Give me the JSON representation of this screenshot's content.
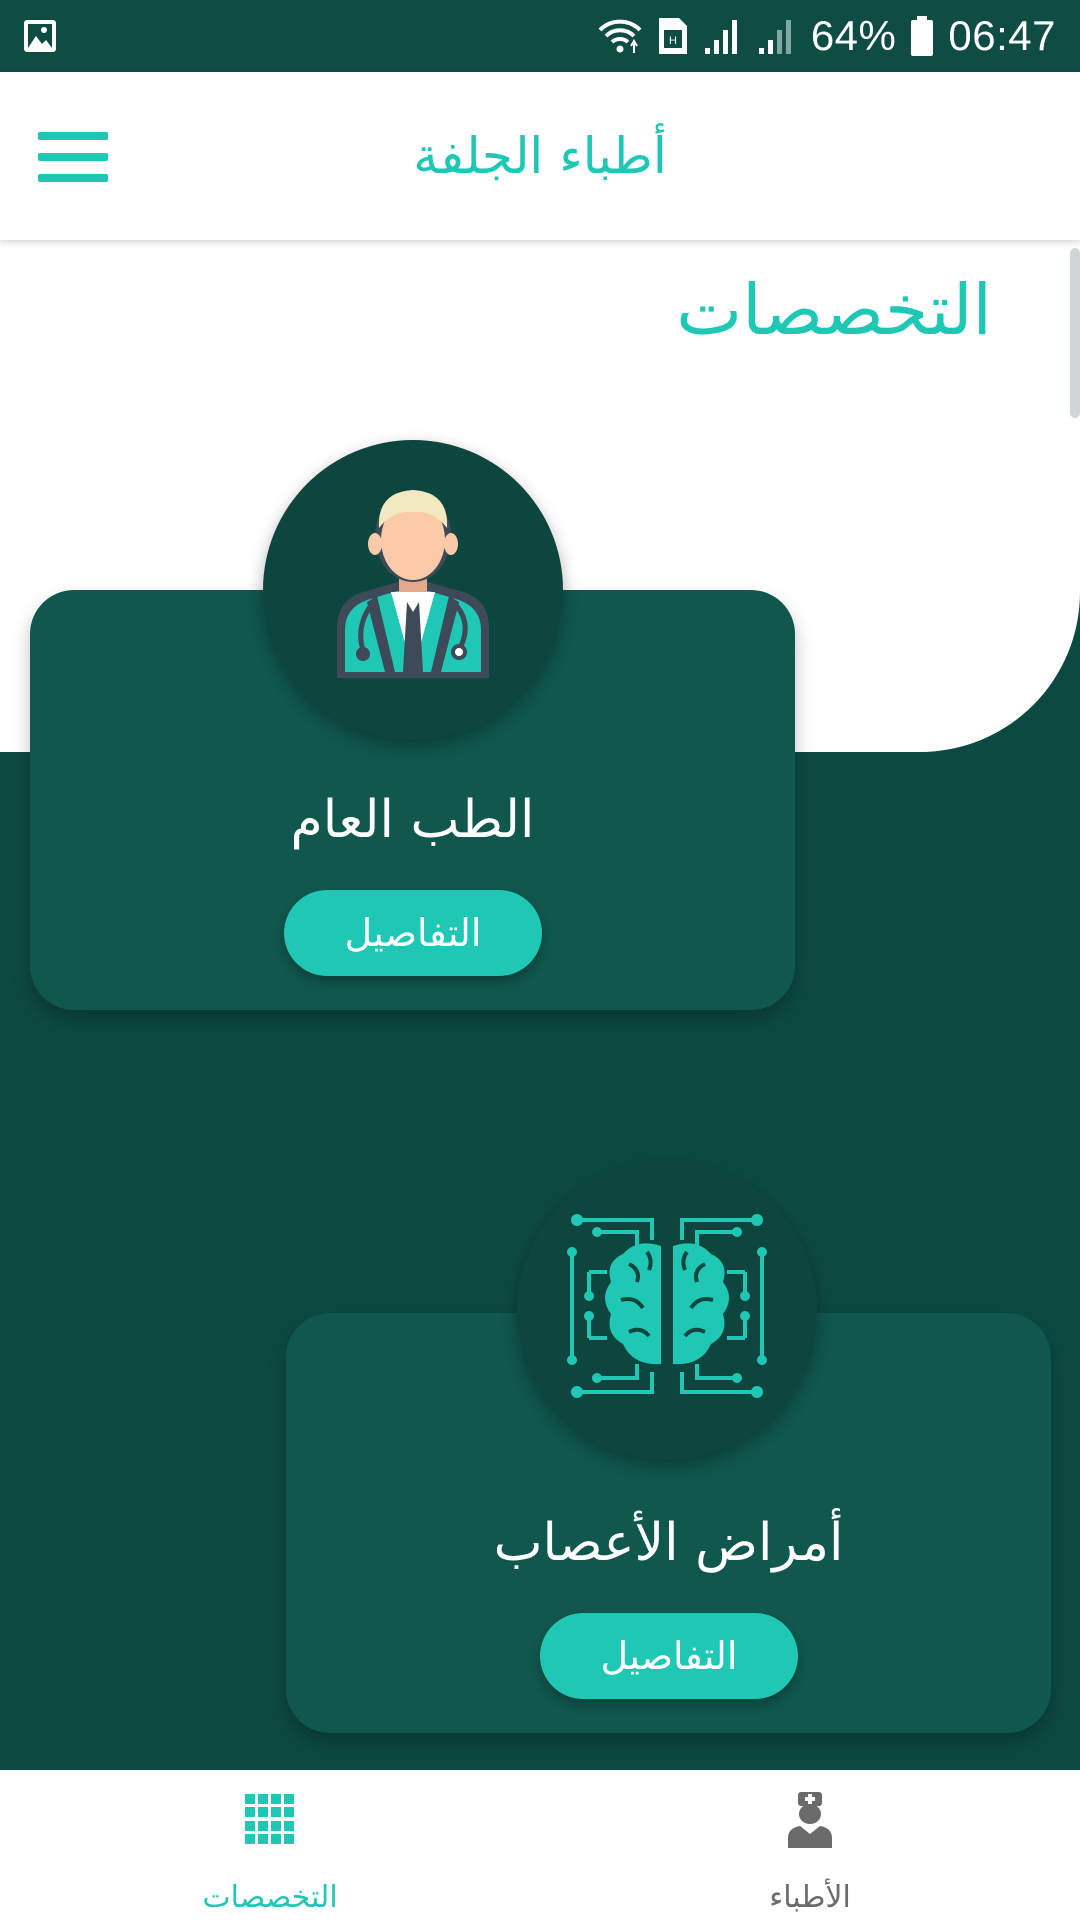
{
  "status_bar": {
    "battery_percent": "64%",
    "time": "06:47"
  },
  "app_bar": {
    "title": "أطباء الجلفة",
    "menu_icon": "hamburger-menu-icon"
  },
  "main": {
    "section_title": "التخصصات",
    "cards": [
      {
        "title": "الطب العام",
        "button_label": "التفاصيل",
        "icon": "doctor-icon"
      },
      {
        "title": "أمراض الأعصاب",
        "button_label": "التفاصيل",
        "icon": "brain-circuit-icon"
      }
    ]
  },
  "bottom_nav": {
    "items": [
      {
        "label": "التخصصات",
        "icon": "grid-icon",
        "active": true
      },
      {
        "label": "الأطباء",
        "icon": "nurse-icon",
        "active": false
      }
    ]
  },
  "colors": {
    "accent": "#1fc7b5",
    "dark_teal": "#0c4a41",
    "card_teal": "#10574d",
    "nav_inactive": "#6b6b6b"
  }
}
